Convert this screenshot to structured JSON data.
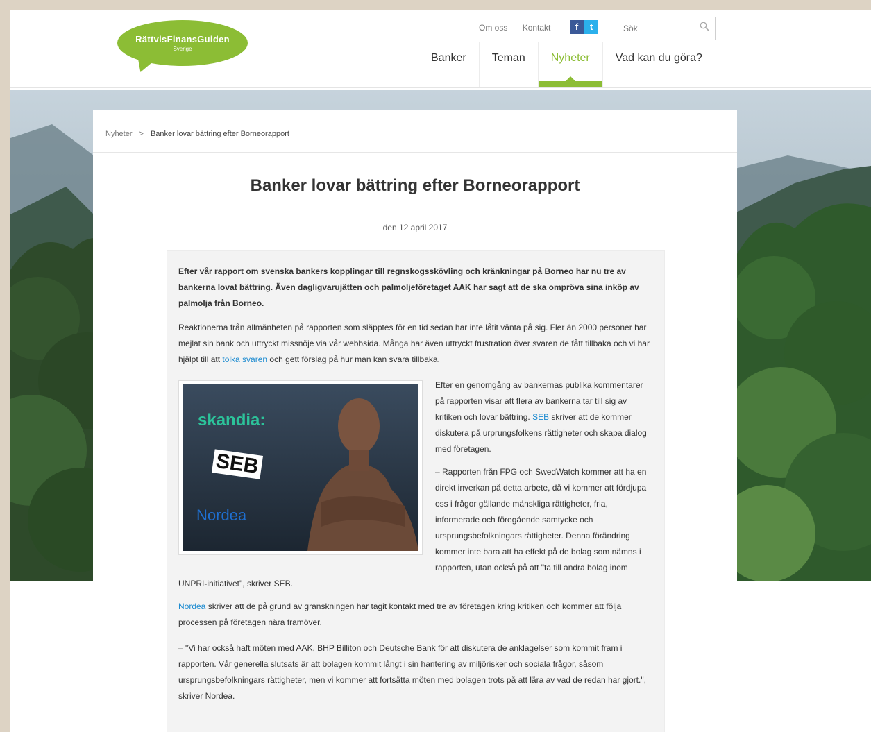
{
  "header": {
    "logo_title": "RättvisFinansGuiden",
    "logo_subtitle": "Sverige",
    "top_links": [
      "Om oss",
      "Kontakt"
    ],
    "social": {
      "facebook": "f",
      "twitter": "t"
    },
    "search_placeholder": "Sök",
    "nav": [
      "Banker",
      "Teman",
      "Nyheter",
      "Vad kan du göra?"
    ],
    "active_nav": "Nyheter",
    "accent_color": "#8cbd35"
  },
  "breadcrumb": {
    "parent": "Nyheter",
    "separator": ">",
    "current": "Banker lovar bättring efter Borneorapport"
  },
  "article": {
    "title": "Banker lovar bättring efter Borneorapport",
    "date": "den 12 april 2017",
    "lead": "Efter vår rapport om svenska bankers kopplingar till regnskogsskövling och kränkningar på Borneo har nu tre av bankerna lovat bättring. Även dagligvarujätten och palmoljeföretaget AAK har sagt att de ska ompröva sina inköp av palmolja från Borneo.",
    "p1_a": "Reaktionerna från allmänheten på rapporten som släpptes för en tid sedan har inte låtit vänta på sig. Fler än 2000 personer har mejlat sin bank och uttryckt missnöje via vår webbsida. Många har även uttryckt frustration över svaren de fått tillbaka och vi har hjälpt till att ",
    "p1_link": "tolka svaren",
    "p1_b": " och gett förslag på hur man kan svara tillbaka.",
    "p2_a": "Efter en genomgång av bankernas publika kommentarer på rapporten visar att flera av bankerna tar till sig av kritiken och lovar bättring. ",
    "p2_link": "SEB",
    "p2_b": " skriver att de kommer diskutera på urprungsfolkens rättigheter och skapa dialog med företagen.",
    "p3": "– Rapporten från FPG och SwedWatch kommer att ha en direkt inverkan på detta arbete, då vi kommer att fördjupa oss i frågor gällande mänskliga rättigheter, fria, informerade och föregående samtycke och ursprungsbefolkningars rättigheter. Denna förändring kommer inte bara att ha effekt på de bolag som nämns i rapporten, utan också på att \"ta till andra bolag inom UNPRI-initiativet\", skriver SEB.",
    "p4_link": "Nordea",
    "p4": " skriver att de på grund av granskningen har tagit kontakt med tre av företagen kring kritiken och kommer att följa processen på företagen nära framöver.",
    "p5": "– \"Vi har också haft möten med AAK, BHP Billiton och Deutsche Bank för att diskutera de anklagelser som kommit fram i rapporten. Vår generella slutsats är att bolagen kommit långt i sin hantering av miljörisker och sociala frågor, såsom ursprungsbefolkningars rättigheter, men vi kommer att fortsätta möten med bolagen trots på att lära av vad de redan har gjort.\", skriver Nordea."
  },
  "image": {
    "brands": [
      "skandia:",
      "SEB",
      "Nordea"
    ]
  },
  "arrows": {
    "prev": "‹",
    "next": "›"
  },
  "colors": {
    "link": "#1a8ad0",
    "box": "#f3f3f3"
  }
}
